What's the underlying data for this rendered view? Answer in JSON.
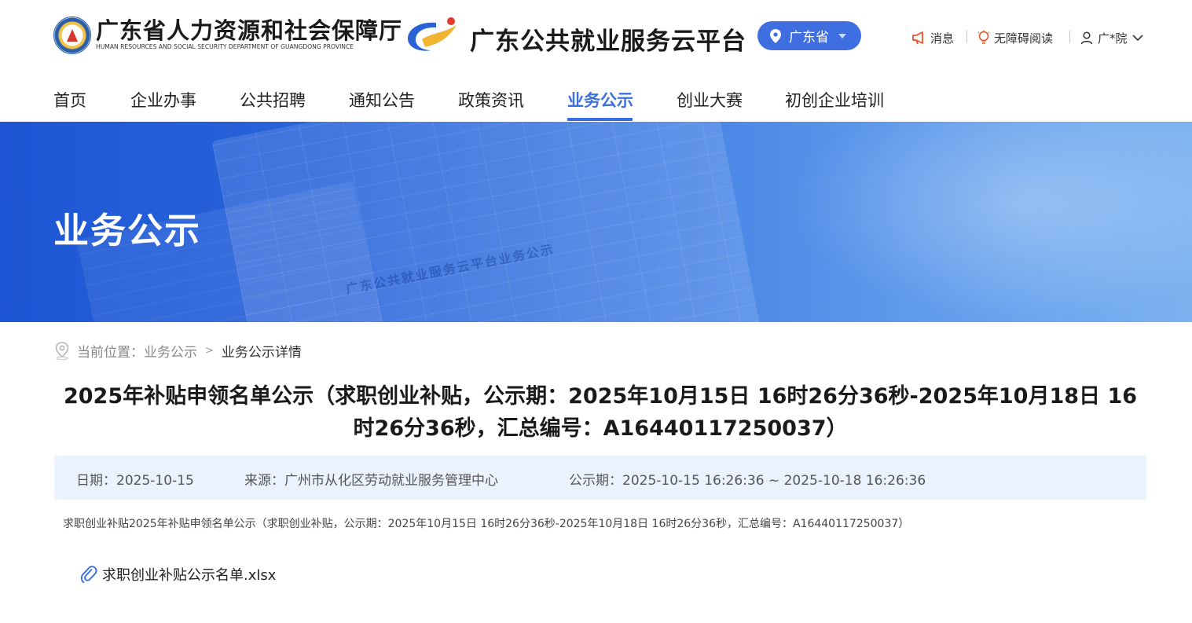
{
  "header": {
    "org_name_cn": "广东省人力资源和社会保障厅",
    "org_name_en": "HUMAN RESOURCES AND SOCIAL SECURITY DEPARTMENT OF GUANGDONG PROVINCE",
    "platform_name": "广东公共就业服务云平台",
    "region_selector": {
      "label": "广东省",
      "icon": "location-pin-icon"
    },
    "utilities": [
      {
        "label": "消息",
        "icon": "megaphone-icon"
      },
      {
        "label": "无障碍阅读",
        "icon": "lightbulb-icon"
      },
      {
        "label": "广*院",
        "icon": "user-icon",
        "caret": "chevron-down-icon"
      }
    ],
    "colors": {
      "accent": "#3b6fe0",
      "region_button": "#3f6ee0",
      "alert_icon": "#e8542b"
    }
  },
  "nav": {
    "items": [
      {
        "label": "首页",
        "active": false
      },
      {
        "label": "企业办事",
        "active": false
      },
      {
        "label": "公共招聘",
        "active": false
      },
      {
        "label": "通知公告",
        "active": false
      },
      {
        "label": "政策资讯",
        "active": false
      },
      {
        "label": "业务公示",
        "active": true
      },
      {
        "label": "创业大赛",
        "active": false
      },
      {
        "label": "初创企业培训",
        "active": false
      }
    ]
  },
  "banner": {
    "title": "业务公示",
    "background_text": "广东公共就业服务云平台业务公示"
  },
  "breadcrumb": {
    "prefix": "当前位置：",
    "parent": "业务公示",
    "separator": ">",
    "current": "业务公示详情"
  },
  "article": {
    "title": "2025年补贴申领名单公示（求职创业补贴，公示期：2025年10月15日 16时26分36秒-2025年10月18日 16时26分36秒，汇总编号：A16440117250037）",
    "meta": {
      "date": "日期：2025-10-15",
      "source": "来源：广州市从化区劳动就业服务管理中心",
      "period": "公示期：2025-10-15 16:26:36 ~ 2025-10-18 16:26:36"
    },
    "summary": "求职创业补贴2025年补贴申领名单公示（求职创业补贴，公示期：2025年10月15日 16时26分36秒-2025年10月18日 16时26分36秒，汇总编号：A16440117250037）",
    "attachment": {
      "name": "求职创业补贴公示名单.xlsx",
      "icon": "paperclip-icon"
    }
  }
}
